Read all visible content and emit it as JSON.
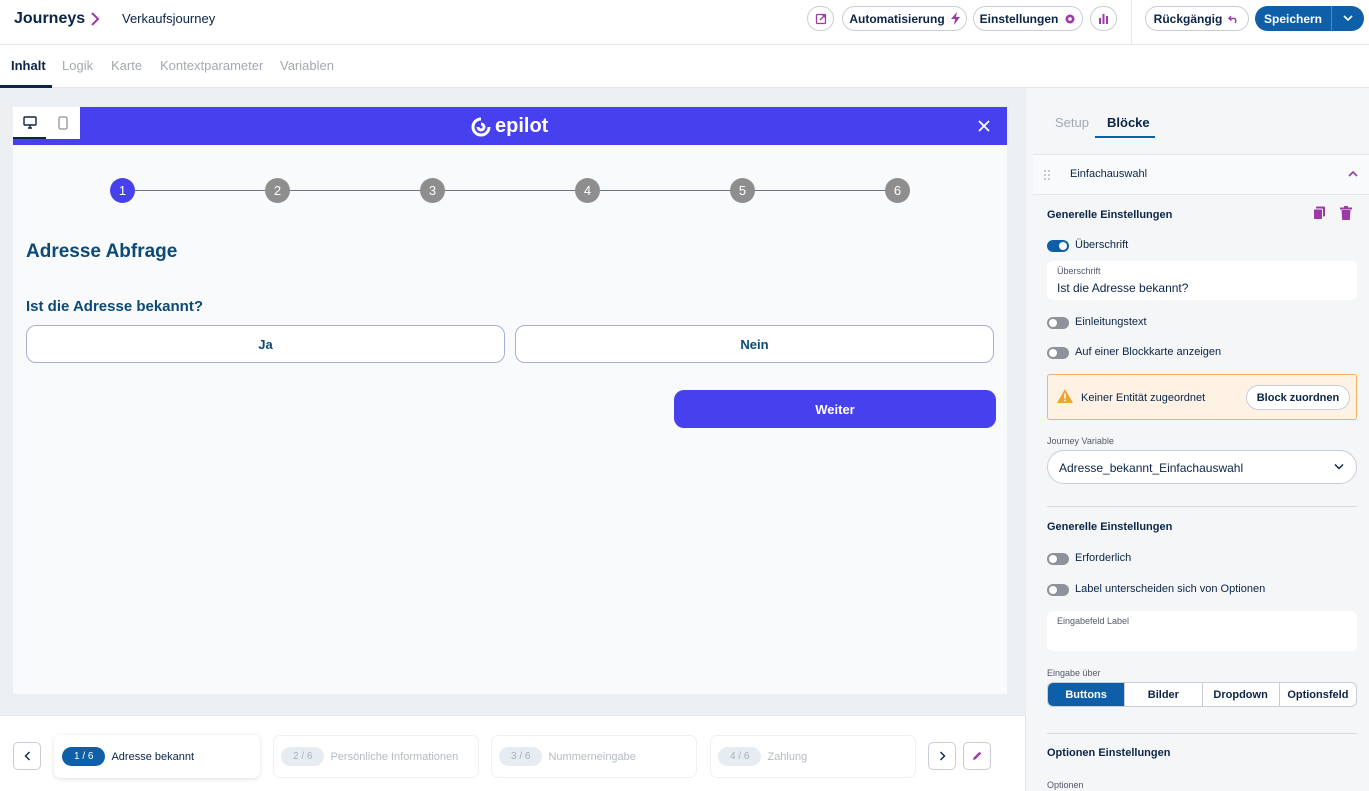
{
  "header": {
    "brand": "Journeys",
    "journey_name": "Verkaufsjourney",
    "automation_label": "Automatisierung",
    "settings_label": "Einstellungen",
    "undo_label": "Rückgängig",
    "save_label": "Speichern"
  },
  "tabs": [
    "Inhalt",
    "Logik",
    "Karte",
    "Kontextparameter",
    "Variablen"
  ],
  "preview": {
    "logo_text": "epilot",
    "steps": [
      "1",
      "2",
      "3",
      "4",
      "5",
      "6"
    ],
    "current_step": 1,
    "title": "Adresse Abfrage",
    "question": "Ist die Adresse bekannt?",
    "options": [
      "Ja",
      "Nein"
    ],
    "next_label": "Weiter"
  },
  "step_nav": [
    {
      "count": "1 / 6",
      "label": "Adresse bekannt",
      "active": true
    },
    {
      "count": "2 / 6",
      "label": "Persönliche Informationen",
      "active": false
    },
    {
      "count": "3 / 6",
      "label": "Nummerneingabe",
      "active": false
    },
    {
      "count": "4 / 6",
      "label": "Zahlung",
      "active": false
    }
  ],
  "panel": {
    "tabs": [
      "Setup",
      "Blöcke"
    ],
    "block_name": "Einfachauswahl",
    "general_settings_title": "Generelle Einstellungen",
    "heading_toggle": "Überschrift",
    "heading_field_label": "Überschrift",
    "heading_field_value": "Ist die Adresse bekannt?",
    "intro_toggle": "Einleitungstext",
    "blockmap_toggle": "Auf einer Blockkarte anzeigen",
    "warning_text": "Keiner Entität zugeordnet",
    "warning_button": "Block zuordnen",
    "variable_label": "Journey Variable",
    "variable_value": "Adresse_bekannt_Einfachauswahl",
    "general_settings_title_2": "Generelle Einstellungen",
    "required_toggle": "Erforderlich",
    "label_differs_toggle": "Label unterscheiden sich von Optionen",
    "input_label_field": "Eingabefeld Label",
    "input_via_label": "Eingabe über",
    "input_via_options": [
      "Buttons",
      "Bilder",
      "Dropdown",
      "Optionsfeld"
    ],
    "input_via_selected": "Buttons",
    "options_settings_title": "Optionen Einstellungen",
    "options_label": "Optionen"
  },
  "colors": {
    "primary": "#0f5fa8",
    "brand": "#4640ee",
    "text": "#0b2447",
    "accent_purple": "#9c3aa8"
  }
}
